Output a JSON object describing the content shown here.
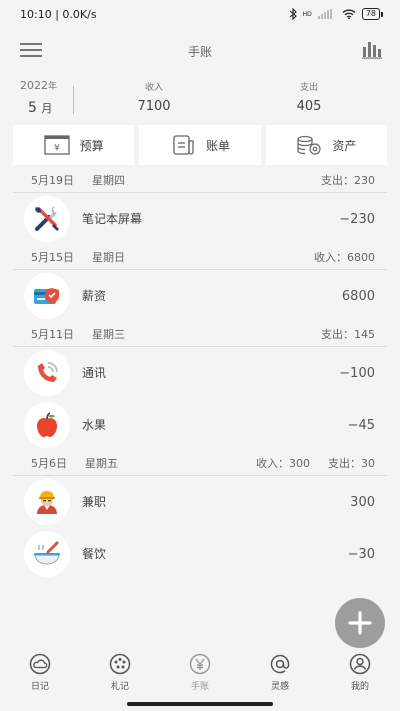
{
  "status": {
    "time": "10:10",
    "network": "0.0K/s",
    "signal_labels": "HD",
    "battery": "78"
  },
  "header": {
    "title": "手账"
  },
  "summary": {
    "year": "2022",
    "year_unit": "年",
    "month": "5",
    "month_unit": "月",
    "income_label": "收入",
    "income_value": "7100",
    "expense_label": "支出",
    "expense_value": "405"
  },
  "quick_actions": {
    "budget": "预算",
    "bill": "账单",
    "assets": "资产"
  },
  "days": [
    {
      "date": "5月19日",
      "weekday": "星期四",
      "totals": [
        "支出：230"
      ],
      "items": [
        {
          "name": "笔记本屏幕",
          "amount": "−230",
          "icon": "tools-icon"
        }
      ]
    },
    {
      "date": "5月15日",
      "weekday": "星期日",
      "totals": [
        "收入：6800"
      ],
      "items": [
        {
          "name": "薪资",
          "amount": "6800",
          "icon": "card-icon"
        }
      ]
    },
    {
      "date": "5月11日",
      "weekday": "星期三",
      "totals": [
        "支出：145"
      ],
      "items": [
        {
          "name": "通讯",
          "amount": "−100",
          "icon": "phone-icon"
        },
        {
          "name": "水果",
          "amount": "−45",
          "icon": "apple-icon"
        }
      ]
    },
    {
      "date": "5月6日",
      "weekday": "星期五",
      "totals": [
        "收入：300",
        "支出：30"
      ],
      "items": [
        {
          "name": "兼职",
          "amount": "300",
          "icon": "worker-icon"
        },
        {
          "name": "餐饮",
          "amount": "−30",
          "icon": "bowl-icon"
        }
      ]
    }
  ],
  "nav": {
    "diary": "日记",
    "notes": "札记",
    "ledger": "手账",
    "inspiration": "灵感",
    "mine": "我的"
  },
  "colors": {
    "accent_red": "#e2513f",
    "nav_active": "#999999",
    "fab": "#9d9d9d"
  }
}
